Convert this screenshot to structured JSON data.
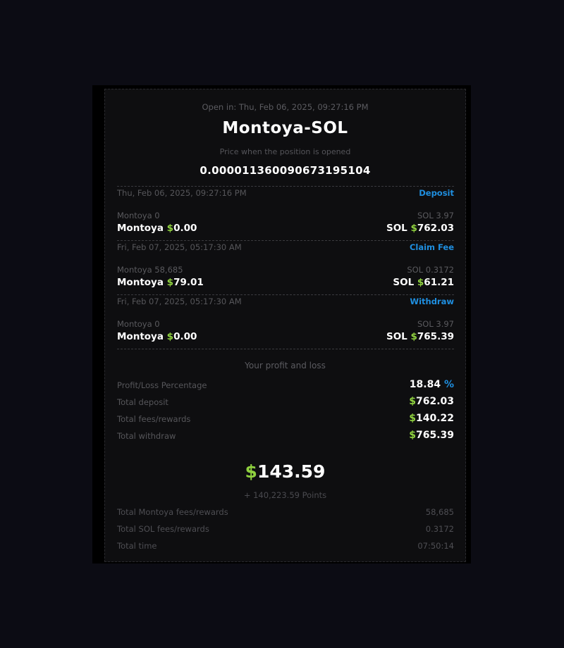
{
  "header": {
    "open_in": "Open in: Thu, Feb 06, 2025, 09:27:16 PM",
    "pair": "Montoya-SOL",
    "price_label": "Price when the position is opened",
    "price_value": "0.000011360090673195104"
  },
  "transactions": [
    {
      "date": "Thu, Feb 06, 2025, 09:27:16 PM",
      "type": "Deposit",
      "token_amount": "Montoya 0",
      "sol_amount": "SOL 3.97",
      "token_prefix": "Montoya ",
      "token_usd": "0.00",
      "sol_prefix": "SOL ",
      "sol_usd": "762.03"
    },
    {
      "date": "Fri, Feb 07, 2025, 05:17:30 AM",
      "type": "Claim Fee",
      "token_amount": "Montoya 58,685",
      "sol_amount": "SOL 0.3172",
      "token_prefix": "Montoya ",
      "token_usd": "79.01",
      "sol_prefix": "SOL ",
      "sol_usd": "61.21"
    },
    {
      "date": "Fri, Feb 07, 2025, 05:17:30 AM",
      "type": "Withdraw",
      "token_amount": "Montoya 0",
      "sol_amount": "SOL 3.97",
      "token_prefix": "Montoya ",
      "token_usd": "0.00",
      "sol_prefix": "SOL ",
      "sol_usd": "765.39"
    }
  ],
  "currency_symbol": "$",
  "pnl": {
    "title": "Your profit and loss",
    "percentage_label": "Profit/Loss Percentage",
    "percentage_value": "18.84",
    "percentage_sign": "%",
    "deposit_label": "Total deposit",
    "deposit_value": "762.03",
    "fees_label": "Total fees/rewards",
    "fees_value": "140.22",
    "withdraw_label": "Total withdraw",
    "withdraw_value": "765.39",
    "total_value": "143.59",
    "points": "+ 140,223.59 Points"
  },
  "summary": {
    "token_fees_label": "Total Montoya fees/rewards",
    "token_fees_value": "58,685",
    "sol_fees_label": "Total SOL fees/rewards",
    "sol_fees_value": "0.3172",
    "time_label": "Total time",
    "time_value": "07:50:14"
  },
  "colors": {
    "accent_blue": "#1f8fe0",
    "dollar_green": "#8fd13f",
    "background": "#0c0c14"
  }
}
